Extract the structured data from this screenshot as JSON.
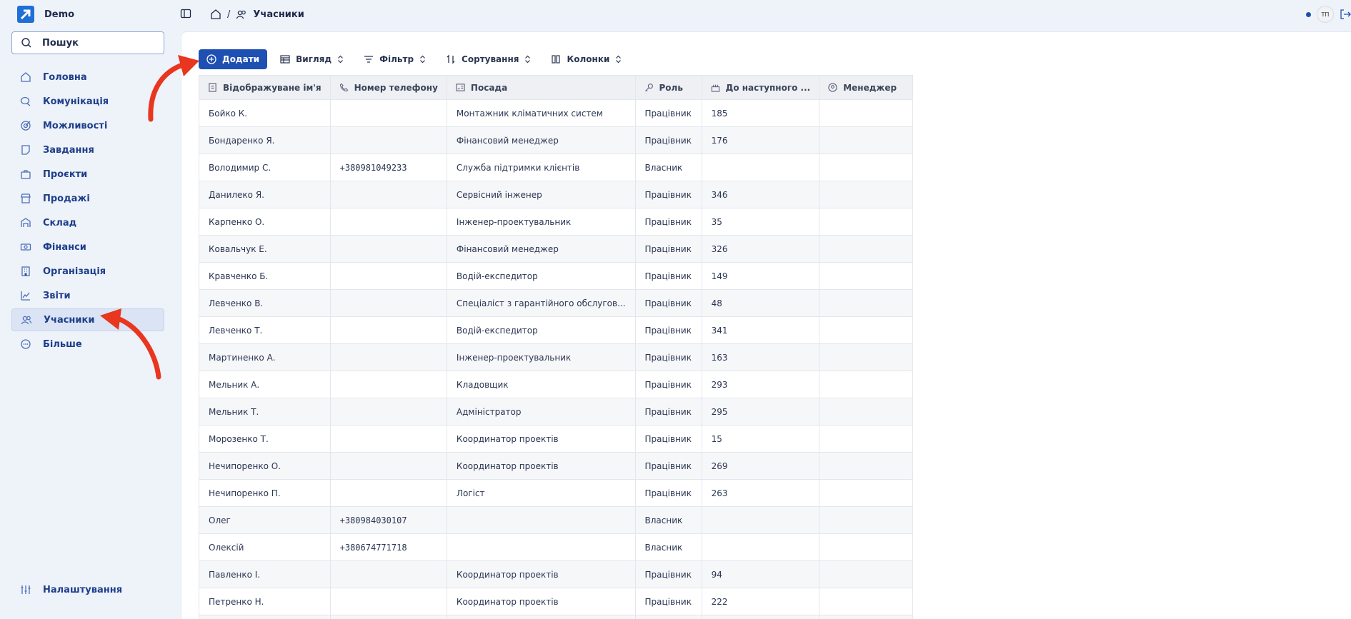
{
  "app": {
    "name": "Demo"
  },
  "search": {
    "label": "Пошук"
  },
  "nav": {
    "items": [
      {
        "label": "Головна",
        "icon": "home-icon"
      },
      {
        "label": "Комунікація",
        "icon": "chat-icon"
      },
      {
        "label": "Можливості",
        "icon": "target-icon"
      },
      {
        "label": "Завдання",
        "icon": "task-icon"
      },
      {
        "label": "Проєкти",
        "icon": "briefcase-icon"
      },
      {
        "label": "Продажі",
        "icon": "store-icon"
      },
      {
        "label": "Склад",
        "icon": "warehouse-icon"
      },
      {
        "label": "Фінанси",
        "icon": "banknote-icon"
      },
      {
        "label": "Організація",
        "icon": "building-icon"
      },
      {
        "label": "Звіти",
        "icon": "chart-icon"
      },
      {
        "label": "Учасники",
        "icon": "users-icon",
        "active": true
      },
      {
        "label": "Більше",
        "icon": "more-icon"
      }
    ],
    "settings": "Налаштування"
  },
  "breadcrumb": {
    "current": "Учасники",
    "separator": "/"
  },
  "user": {
    "initials": "ТП"
  },
  "toolbar": {
    "add": "Додати",
    "view": "Вигляд",
    "filter": "Фільтр",
    "sort": "Сортування",
    "columns": "Колонки"
  },
  "table": {
    "columns": [
      "Відображуване ім'я",
      "Номер телефону",
      "Посада",
      "Роль",
      "До наступного ...",
      "Менеджер"
    ],
    "rows": [
      [
        "Бойко К.",
        "",
        "Монтажник кліматичних систем",
        "Працівник",
        "185",
        ""
      ],
      [
        "Бондаренко Я.",
        "",
        "Фінансовий менеджер",
        "Працівник",
        "176",
        ""
      ],
      [
        "Володимир С.",
        "+380981049233",
        "Служба підтримки клієнтів",
        "Власник",
        "",
        ""
      ],
      [
        "Данилеко Я.",
        "",
        "Сервісний інженер",
        "Працівник",
        "346",
        ""
      ],
      [
        "Карпенко О.",
        "",
        "Інженер-проектувальник",
        "Працівник",
        "35",
        ""
      ],
      [
        "Ковальчук Е.",
        "",
        "Фінансовий менеджер",
        "Працівник",
        "326",
        ""
      ],
      [
        "Кравченко Б.",
        "",
        "Водій-експедитор",
        "Працівник",
        "149",
        ""
      ],
      [
        "Левченко В.",
        "",
        "Спеціаліст з гарантійного обслугов...",
        "Працівник",
        "48",
        ""
      ],
      [
        "Левченко Т.",
        "",
        "Водій-експедитор",
        "Працівник",
        "341",
        ""
      ],
      [
        "Мартиненко А.",
        "",
        "Інженер-проектувальник",
        "Працівник",
        "163",
        ""
      ],
      [
        "Мельник А.",
        "",
        "Кладовщик",
        "Працівник",
        "293",
        ""
      ],
      [
        "Мельник Т.",
        "",
        "Адміністратор",
        "Працівник",
        "295",
        ""
      ],
      [
        "Морозенко Т.",
        "",
        "Координатор проектів",
        "Працівник",
        "15",
        ""
      ],
      [
        "Нечипоренко О.",
        "",
        "Координатор проектів",
        "Працівник",
        "269",
        ""
      ],
      [
        "Нечипоренко П.",
        "",
        "Логіст",
        "Працівник",
        "263",
        ""
      ],
      [
        "Олег",
        "+380984030107",
        "",
        "Власник",
        "",
        ""
      ],
      [
        "Олексій",
        "+380674771718",
        "",
        "Власник",
        "",
        ""
      ],
      [
        "Павленко І.",
        "",
        "Координатор проектів",
        "Працівник",
        "94",
        ""
      ],
      [
        "Петренко Н.",
        "",
        "Координатор проектів",
        "Працівник",
        "222",
        ""
      ],
      [
        "",
        "",
        "",
        "",
        "",
        ""
      ]
    ]
  },
  "colors": {
    "accent": "#1e4fb3",
    "annotation_arrow": "#e8361f"
  }
}
